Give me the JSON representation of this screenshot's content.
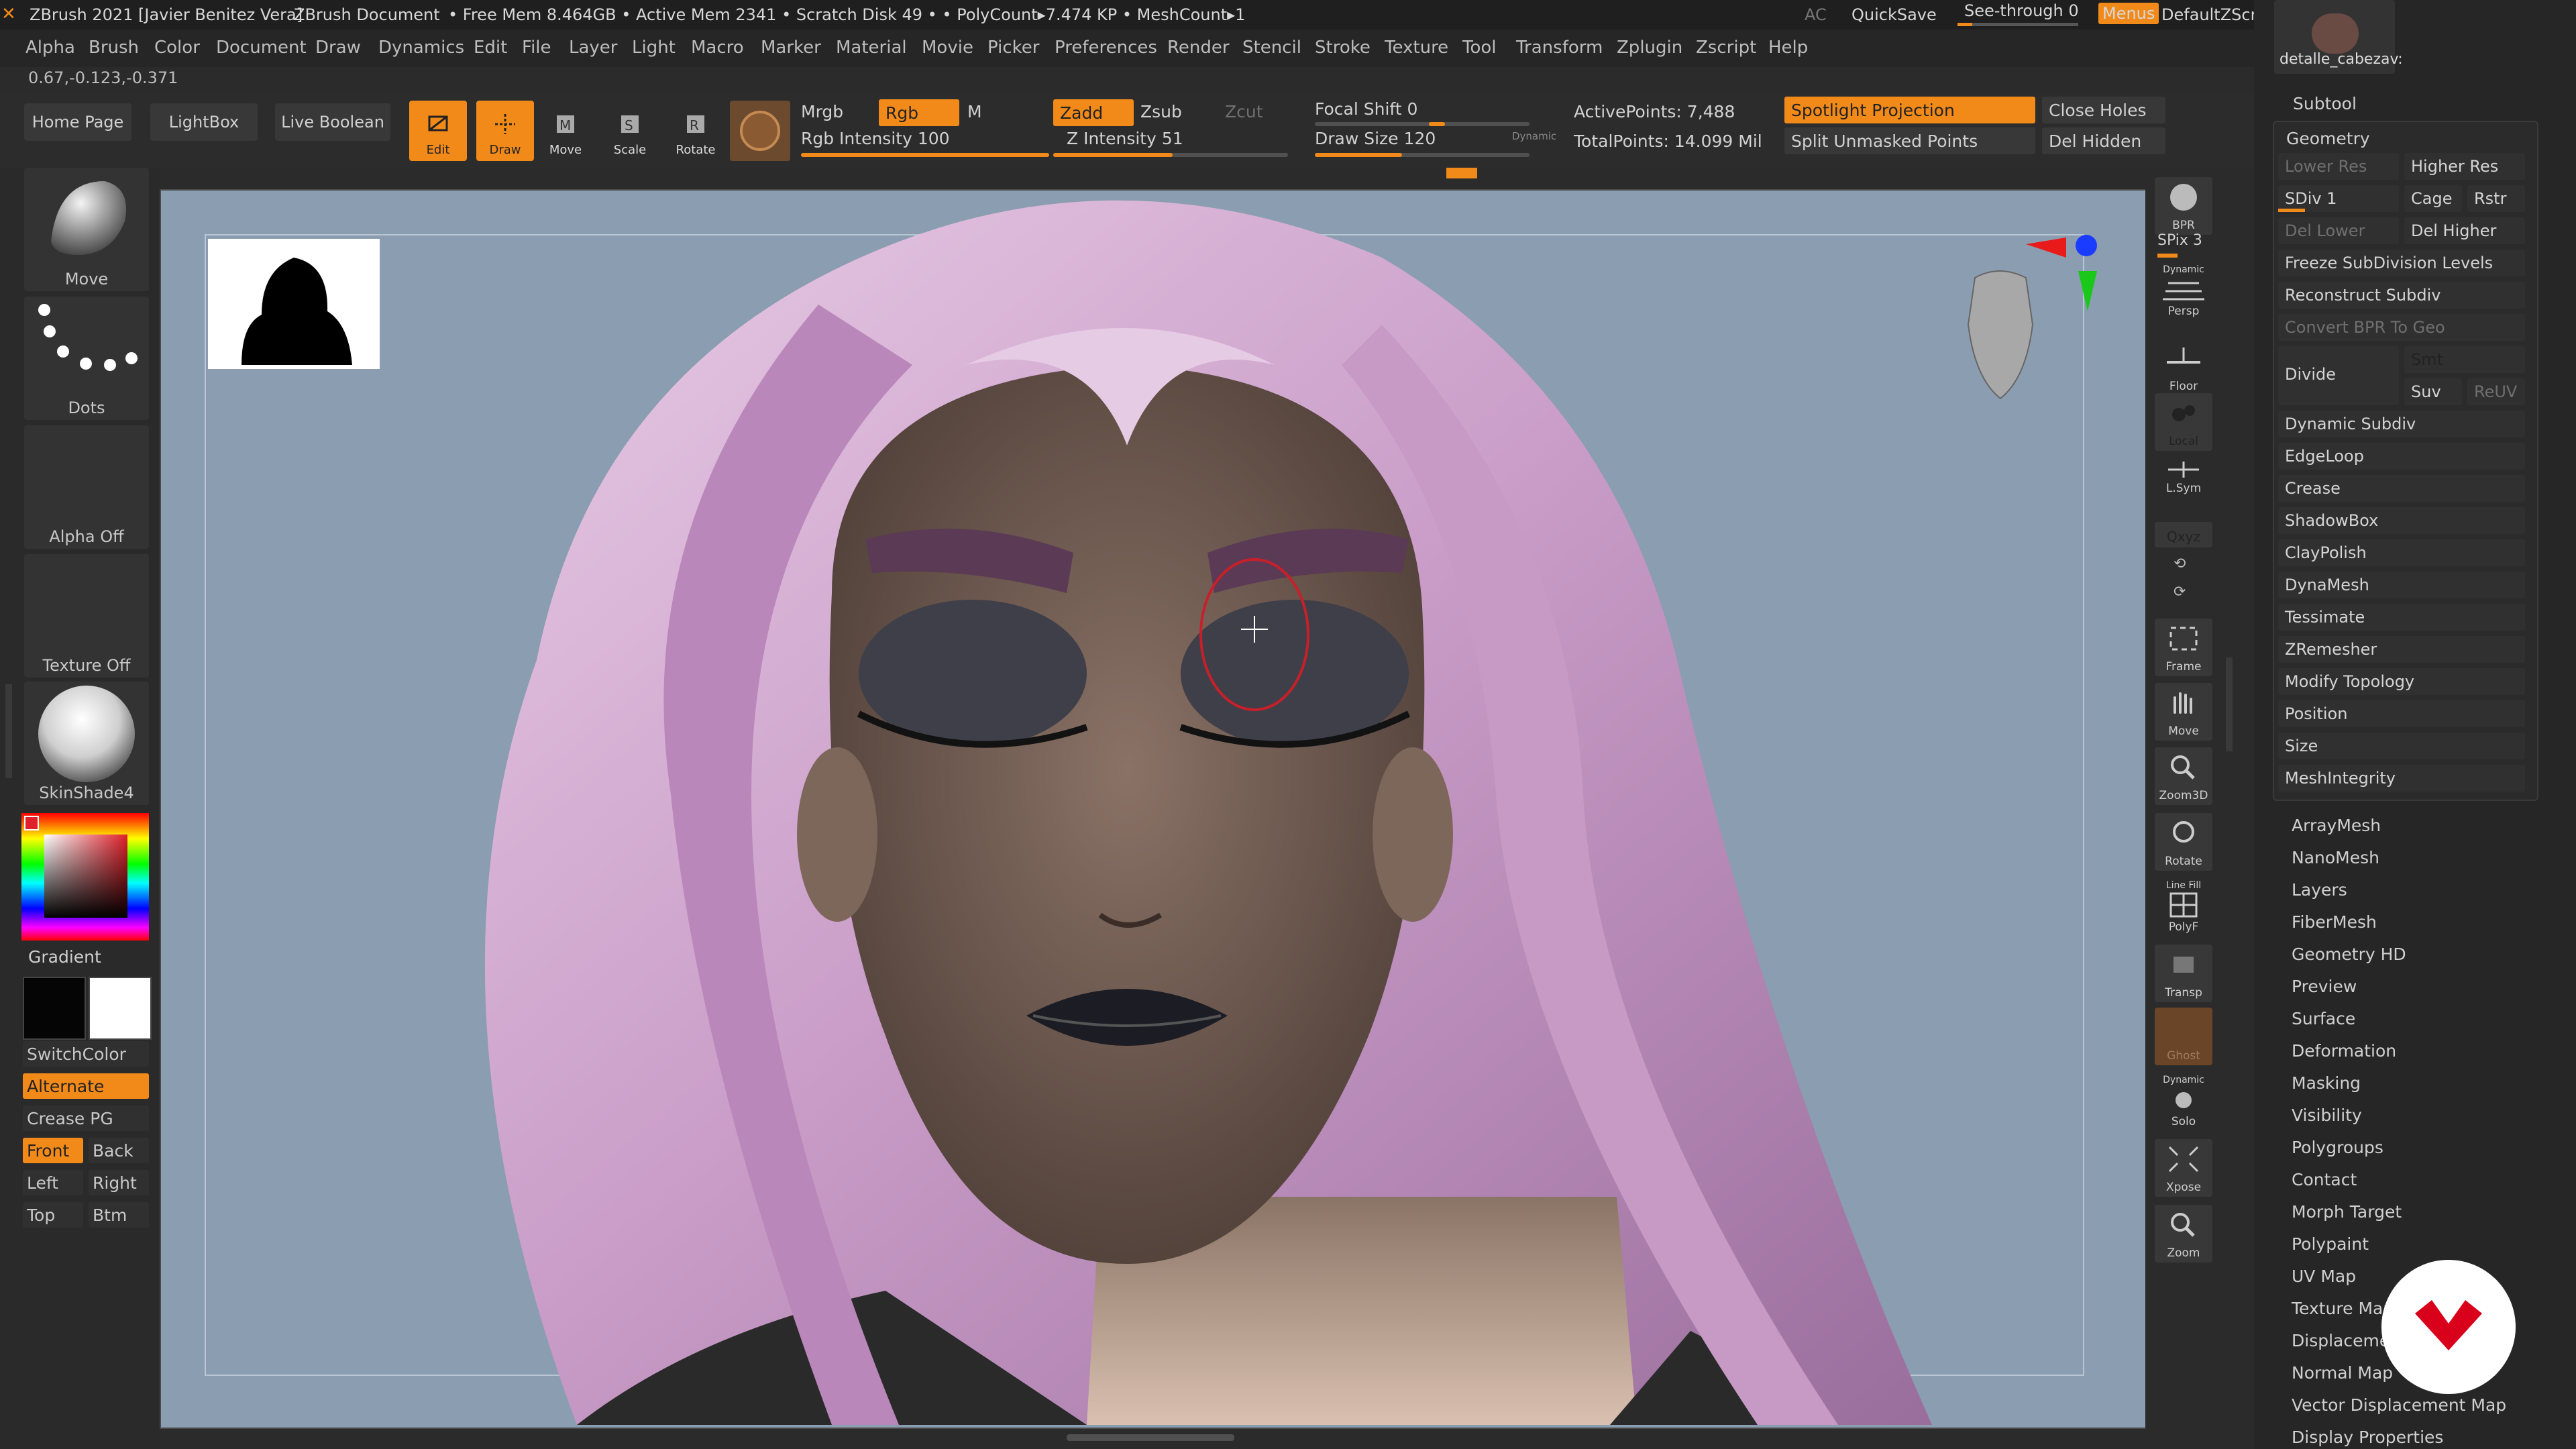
{
  "titlebar": {
    "app": "ZBrush 2021 [Javier Benitez Vera]",
    "doc": "ZBrush Document",
    "stats": "• Free Mem 8.464GB • Active Mem 2341 • Scratch Disk 49 • • PolyCount▸7.474 KP • MeshCount▸1",
    "ac": "AC",
    "quicksave": "QuickSave",
    "seethrough": "See-through  0",
    "menus": "Menus",
    "script": "DefaultZScript",
    "tool_name": "detalle_cabezav:"
  },
  "menubar": [
    "Alpha",
    "Brush",
    "Color",
    "Document",
    "Draw",
    "Dynamics",
    "Edit",
    "File",
    "Layer",
    "Light",
    "Macro",
    "Marker",
    "Material",
    "Movie",
    "Picker",
    "Preferences",
    "Render",
    "Stencil",
    "Stroke",
    "Texture",
    "Tool",
    "Transform",
    "Zplugin",
    "Zscript",
    "Help"
  ],
  "coords": "0.67,-0.123,-0.371",
  "shelf": {
    "home": "Home Page",
    "lightbox": "LightBox",
    "liveboolean": "Live Boolean",
    "edit": "Edit",
    "draw": "Draw",
    "move": "Move",
    "scale": "Scale",
    "rotate": "Rotate",
    "mrgb": "Mrgb",
    "rgb": "Rgb",
    "m": "M",
    "rgb_intensity": "Rgb Intensity 100",
    "zadd": "Zadd",
    "zsub": "Zsub",
    "zcut": "Zcut",
    "z_intensity": "Z Intensity 51",
    "focal_shift": "Focal Shift 0",
    "draw_size": "Draw Size 120",
    "dynamic": "Dynamic",
    "active_points": "ActivePoints: 7,488",
    "total_points": "TotalPoints: 14.099 Mil",
    "spotlight": "Spotlight Projection",
    "split_unmasked": "Split Unmasked Points",
    "close_holes": "Close Holes",
    "del_hidden": "Del Hidden"
  },
  "leftpal": {
    "brush": "Move",
    "stroke": "Dots",
    "alpha": "Alpha Off",
    "texture": "Texture Off",
    "material": "SkinShade4",
    "gradient": "Gradient",
    "switchcolor": "SwitchColor",
    "alternate": "Alternate",
    "crease": "Crease PG",
    "front": "Front",
    "back": "Back",
    "left": "Left",
    "right": "Right",
    "top": "Top",
    "btm": "Btm"
  },
  "rshelf": {
    "bpr": "BPR",
    "spix": "SPix 3",
    "persp": "Persp",
    "dynamic": "Dynamic",
    "floor": "Floor",
    "local": "Local",
    "lsym": "L.Sym",
    "xyz": "Qxyz",
    "frame": "Frame",
    "move": "Move",
    "zoom3d": "Zoom3D",
    "rotate": "Rotate",
    "linefill": "Line Fill",
    "polyf": "PolyF",
    "transp": "Transp",
    "ghost": "Ghost",
    "solo": "Solo",
    "xpose": "Xpose",
    "zoom": "Zoom"
  },
  "rpanel": {
    "subtool": "Subtool",
    "geometry": "Geometry",
    "lower_res": "Lower Res",
    "higher_res": "Higher Res",
    "sdiv": "SDiv 1",
    "cage": "Cage",
    "rstr": "Rstr",
    "del_lower": "Del Lower",
    "del_higher": "Del Higher",
    "freeze": "Freeze SubDivision Levels",
    "reconstruct": "Reconstruct Subdiv",
    "convert_bpr": "Convert BPR To Geo",
    "divide": "Divide",
    "smt": "Smt",
    "suv": "Suv",
    "reuv": "ReUV",
    "geo_items": [
      "Dynamic Subdiv",
      "EdgeLoop",
      "Crease",
      "ShadowBox",
      "ClayPolish",
      "DynaMesh",
      "Tessimate",
      "ZRemesher",
      "Modify Topology",
      "Position",
      "Size",
      "MeshIntegrity"
    ],
    "sections": [
      "ArrayMesh",
      "NanoMesh",
      "Layers",
      "FiberMesh",
      "Geometry HD",
      "Preview",
      "Surface",
      "Deformation",
      "Masking",
      "Visibility",
      "Polygroups",
      "Contact",
      "Morph Target",
      "Polypaint",
      "UV Map",
      "Texture Map",
      "Displacement Map",
      "Normal Map",
      "Vector Displacement Map",
      "Display Properties"
    ]
  },
  "colors": {
    "accent": "#f28a1a",
    "viewport_bg": "#8b9db0"
  }
}
